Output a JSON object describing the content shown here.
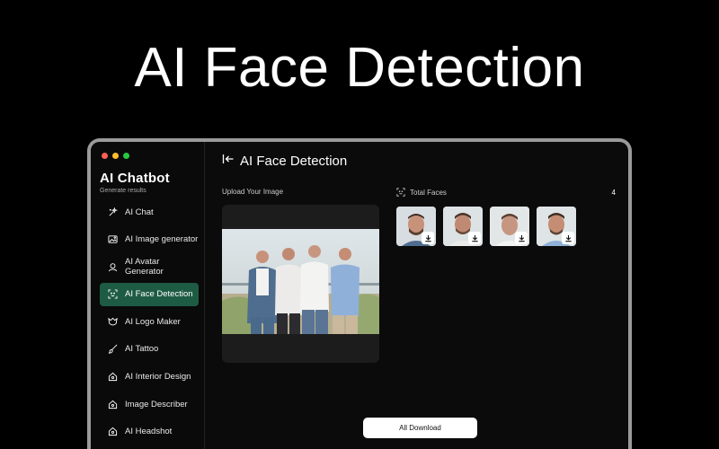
{
  "hero": {
    "title": "AI Face Detection"
  },
  "brand": {
    "name": "AI Chatbot",
    "subtitle": "Generate results"
  },
  "sidebar": {
    "items": [
      {
        "label": "AI Chat",
        "icon": "sparkle-icon"
      },
      {
        "label": "AI Image generator",
        "icon": "image-icon"
      },
      {
        "label": "AI Avatar Generator",
        "icon": "avatar-icon"
      },
      {
        "label": "AI Face Detection",
        "icon": "face-scan-icon",
        "active": true
      },
      {
        "label": "AI Logo Maker",
        "icon": "logo-icon"
      },
      {
        "label": "AI Tattoo",
        "icon": "brush-icon"
      },
      {
        "label": "AI Interior Design",
        "icon": "home-icon"
      },
      {
        "label": "Image Describer",
        "icon": "home-icon"
      },
      {
        "label": "AI Headshot",
        "icon": "home-icon"
      }
    ]
  },
  "main": {
    "title": "AI Face Detection",
    "upload_label": "Upload Your Image",
    "faces_label": "Total Faces",
    "faces_count": "4",
    "download_all": "All Download"
  },
  "colors": {
    "accent": "#1e5b45",
    "background": "#000000",
    "panel": "#1c1c1c"
  }
}
